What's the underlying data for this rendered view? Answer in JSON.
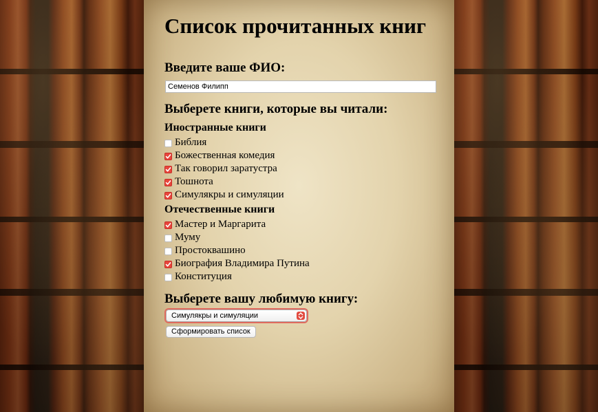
{
  "page": {
    "title": "Список прочитанных книг"
  },
  "name_section": {
    "label": "Введите ваше ФИО:",
    "value": "Семенов Филипп"
  },
  "books_section": {
    "label": "Выберете книги, которые вы читали:",
    "foreign": {
      "label": "Иностранные книги",
      "items": [
        {
          "label": "Библия",
          "checked": false
        },
        {
          "label": "Божественная комедия",
          "checked": true
        },
        {
          "label": "Так говорил заратустра",
          "checked": true
        },
        {
          "label": "Тошнота",
          "checked": true
        },
        {
          "label": "Симулякры и симуляции",
          "checked": true
        }
      ]
    },
    "domestic": {
      "label": "Отечественные книги",
      "items": [
        {
          "label": "Мастер и Маргарита",
          "checked": true
        },
        {
          "label": "Муму",
          "checked": false
        },
        {
          "label": "Простоквашино",
          "checked": false
        },
        {
          "label": "Биография Владимира Путина",
          "checked": true
        },
        {
          "label": "Конституция",
          "checked": false
        }
      ]
    }
  },
  "favorite_section": {
    "label": "Выберете вашу любимую книгу:",
    "selected": "Симулякры и симуляции"
  },
  "submit": {
    "label": "Сформировать список"
  },
  "colors": {
    "checkbox_accent": "#e8453c",
    "select_focus": "#e06a5e"
  },
  "icons": {
    "checkmark": "checkmark-icon",
    "select_arrow": "chevron-up-down-icon",
    "background": "bookshelf-image"
  }
}
